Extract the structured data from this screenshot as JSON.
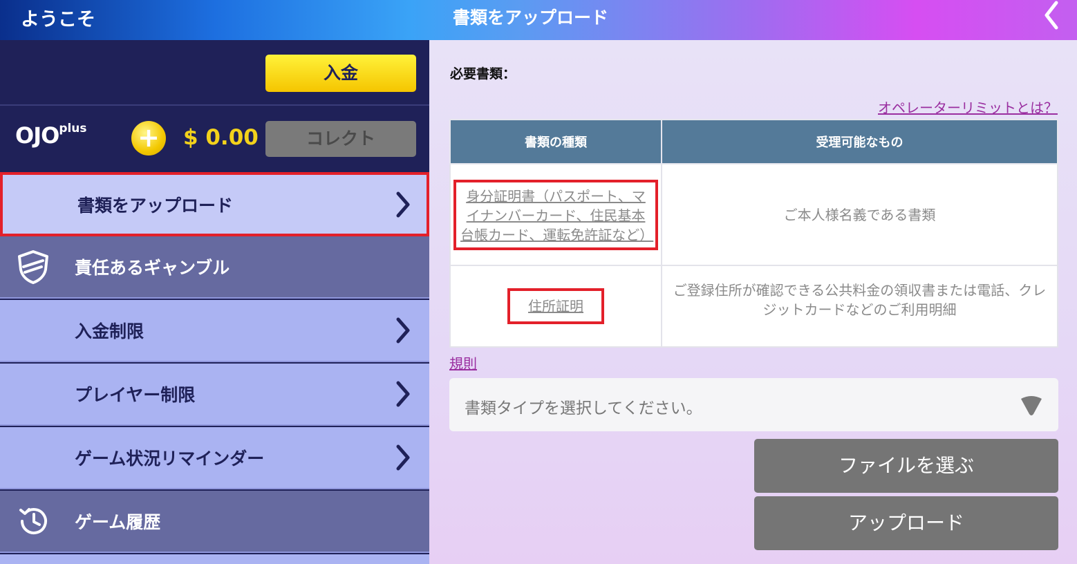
{
  "header": {
    "welcome": "ようこそ",
    "title": "書類をアップロード",
    "back_icon": "chevron-left-icon"
  },
  "wallet": {
    "deposit_label": "入金",
    "brand_name": "OJO",
    "brand_suffix": "plus",
    "coin_symbol": "+",
    "balance": "$ 0.00",
    "collect_label": "コレクト"
  },
  "sidebar": {
    "items": [
      {
        "label": "書類をアップロード",
        "state": "active",
        "chevron": true
      },
      {
        "label": "責任あるギャンブル",
        "icon": "shield-icon",
        "chevron": false
      },
      {
        "label": "入金制限",
        "chevron": true
      },
      {
        "label": "プレイヤー制限",
        "chevron": true
      },
      {
        "label": "ゲーム状況リマインダー",
        "chevron": true
      },
      {
        "label": "ゲーム履歴",
        "icon": "history-icon",
        "chevron": false
      }
    ]
  },
  "main": {
    "required_docs_label": "必要書類：",
    "operator_limit_link": "オペレーターリミットとは？",
    "table": {
      "headers": [
        "書類の種類",
        "受理可能なもの"
      ],
      "rows": [
        {
          "type": "身分証明書（パスポート、マイナンバーカード、住民基本台帳カード、運転免許証など）",
          "accepted": "ご本人様名義である書類"
        },
        {
          "type": "住所証明",
          "accepted": "ご登録住所が確認できる公共料金の領収書または電話、クレジットカードなどのご利用明細"
        }
      ]
    },
    "rules_link": "規則",
    "doc_type_select": {
      "placeholder": "書類タイプを選択してください。"
    },
    "choose_file_label": "ファイルを選ぶ",
    "upload_label": "アップロード"
  },
  "colors": {
    "accent_red": "#e3202a",
    "link_purple": "#9a2ea0",
    "deposit_yellow": "#f5c500",
    "sidebar_dark": "#1f2158"
  }
}
